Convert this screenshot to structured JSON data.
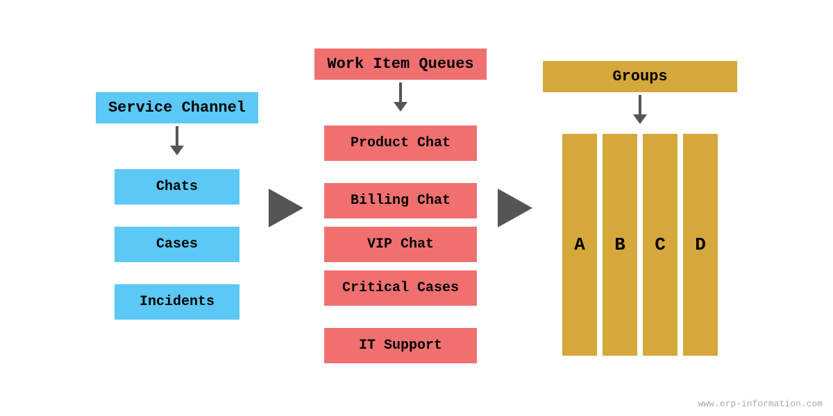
{
  "diagram": {
    "service_channel": {
      "header": "Service Channel",
      "items": [
        "Chats",
        "Cases",
        "Incidents"
      ]
    },
    "work_item_queues": {
      "header": "Work Item Queues",
      "items": [
        "Product Chat",
        "Billing Chat",
        "VIP Chat",
        "Critical Cases",
        "IT Support"
      ]
    },
    "groups": {
      "header": "Groups",
      "bars": [
        "A",
        "B",
        "C",
        "D"
      ]
    }
  },
  "watermark": "www.erp-information.com",
  "colors": {
    "blue": "#5BC8F5",
    "red": "#F07070",
    "yellow": "#D4A83A",
    "arrow": "#555555"
  }
}
